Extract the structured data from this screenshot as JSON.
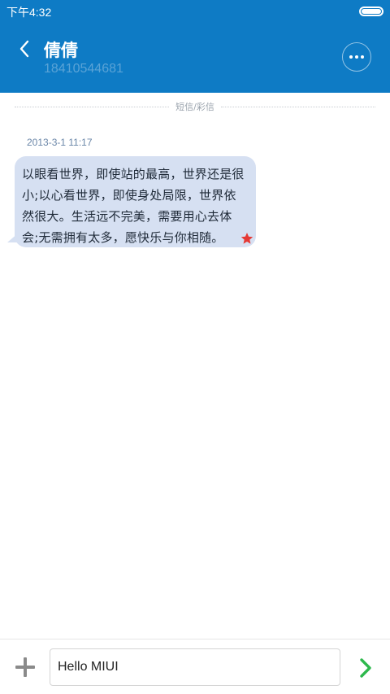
{
  "status_bar": {
    "time": "下午4:32",
    "battery_level_percent": 100
  },
  "header": {
    "contact_name": "倩倩",
    "contact_number": "18410544681",
    "back_icon": "chevron-left-icon",
    "more_icon": "more-horizontal-icon"
  },
  "thread": {
    "divider_label": "短信/彩信",
    "messages": [
      {
        "timestamp": "2013-3-1 11:17",
        "text": "以眼看世界，即使站的最高，世界还是很小;以心看世界，即使身处局限，世界依然很大。生活远不完美，需要用心去体会;无需拥有太多，愿快乐与你相随。",
        "starred": true
      }
    ]
  },
  "compose": {
    "input_value": "Hello MIUI",
    "plus_icon": "plus-icon",
    "send_icon": "send-chevron-icon"
  },
  "colors": {
    "header_bg": "#0e7bc5",
    "bubble_bg": "#d6e0f2",
    "star": "#e53935",
    "send": "#2db84c"
  }
}
